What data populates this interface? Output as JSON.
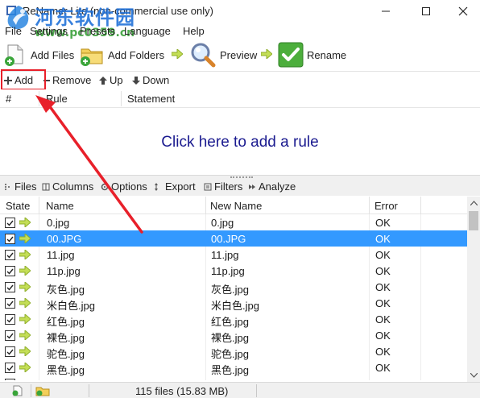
{
  "window": {
    "title": "ReNamer Lite (non-commercial use only)",
    "controls": [
      "minimize",
      "maximize",
      "close"
    ]
  },
  "watermark": {
    "name": "河东软件园",
    "url": "www.pc0359.cn"
  },
  "menu": [
    "File",
    "Settings",
    "Presets",
    "Language",
    "Help"
  ],
  "toolbar": {
    "add_files": "Add Files",
    "add_folders": "Add Folders",
    "preview": "Preview",
    "rename": "Rename"
  },
  "rules_toolbar": {
    "add": "Add",
    "remove": "Remove",
    "up": "Up",
    "down": "Down"
  },
  "rules_table": {
    "columns": [
      "#",
      "Rule",
      "Statement"
    ],
    "empty_text": "Click here to add a rule"
  },
  "files_toolbar": {
    "files": "Files",
    "columns": "Columns",
    "options": "Options",
    "export": "Export",
    "filters": "Filters",
    "analyze": "Analyze"
  },
  "files_table": {
    "columns": [
      "State",
      "Name",
      "New Name",
      "Error"
    ],
    "rows": [
      {
        "name": "0.jpg",
        "new_name": "0.jpg",
        "error": "OK",
        "checked": true,
        "selected": false
      },
      {
        "name": "00.JPG",
        "new_name": "00.JPG",
        "error": "OK",
        "checked": true,
        "selected": true
      },
      {
        "name": "11.jpg",
        "new_name": "11.jpg",
        "error": "OK",
        "checked": true,
        "selected": false
      },
      {
        "name": "11p.jpg",
        "new_name": "11p.jpg",
        "error": "OK",
        "checked": true,
        "selected": false
      },
      {
        "name": "灰色.jpg",
        "new_name": "灰色.jpg",
        "error": "OK",
        "checked": true,
        "selected": false
      },
      {
        "name": "米白色.jpg",
        "new_name": "米白色.jpg",
        "error": "OK",
        "checked": true,
        "selected": false
      },
      {
        "name": "红色.jpg",
        "new_name": "红色.jpg",
        "error": "OK",
        "checked": true,
        "selected": false
      },
      {
        "name": "裸色.jpg",
        "new_name": "裸色.jpg",
        "error": "OK",
        "checked": true,
        "selected": false
      },
      {
        "name": "驼色.jpg",
        "new_name": "驼色.jpg",
        "error": "OK",
        "checked": true,
        "selected": false
      },
      {
        "name": "黑色.jpg",
        "new_name": "黑色.jpg",
        "error": "OK",
        "checked": true,
        "selected": false
      }
    ]
  },
  "status": {
    "text": "115 files (15.83 MB)"
  },
  "colors": {
    "selection": "#3399ff",
    "annotation": "#e8202a",
    "link": "#1a1a8f",
    "ok_arrow": "#2e9e2e"
  }
}
